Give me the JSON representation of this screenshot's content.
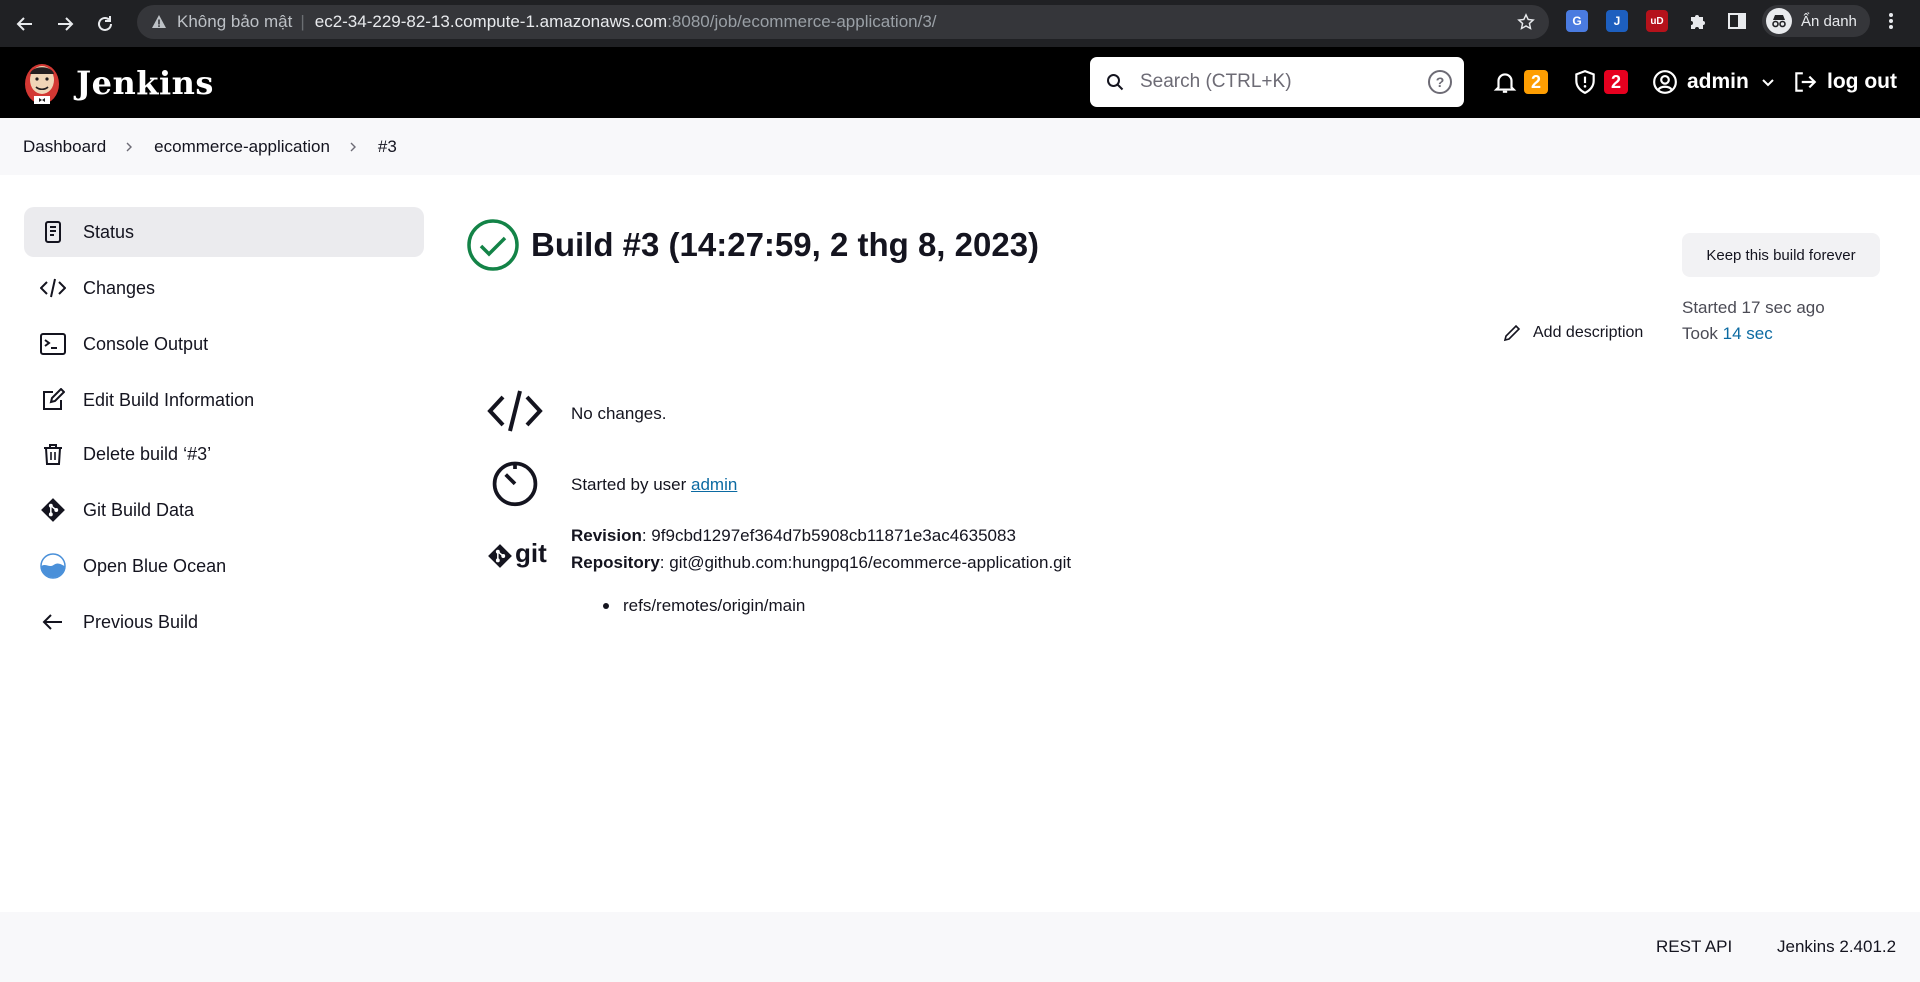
{
  "browser": {
    "insecure_label": "Không bảo mật",
    "url_host": "ec2-34-229-82-13.compute-1.amazonaws.com",
    "url_path": ":8080/job/ecommerce-application/3/",
    "profile_label": "Ẩn danh"
  },
  "header": {
    "brand": "Jenkins",
    "search_placeholder": "Search (CTRL+K)",
    "notifications_count": "2",
    "security_count": "2",
    "user": "admin",
    "logout": "log out",
    "colors": {
      "notif_badge": "#fe9e02",
      "security_badge": "#e6001f"
    }
  },
  "breadcrumb": [
    "Dashboard",
    "ecommerce-application",
    "#3"
  ],
  "sidebar": {
    "items": [
      {
        "label": "Status",
        "icon": "status-icon"
      },
      {
        "label": "Changes",
        "icon": "code-icon"
      },
      {
        "label": "Console Output",
        "icon": "terminal-icon"
      },
      {
        "label": "Edit Build Information",
        "icon": "edit-icon"
      },
      {
        "label": "Delete build ‘#3’",
        "icon": "trash-icon"
      },
      {
        "label": "Git Build Data",
        "icon": "git-icon"
      },
      {
        "label": "Open Blue Ocean",
        "icon": "blue-ocean-icon"
      },
      {
        "label": "Previous Build",
        "icon": "arrow-left-icon"
      }
    ]
  },
  "build": {
    "title": "Build #3 (14:27:59, 2 thg 8, 2023)",
    "keep_label": "Keep this build forever",
    "add_description": "Add description",
    "started": "Started 17 sec ago",
    "took_prefix": "Took",
    "took_value": "14 sec",
    "changes": "No changes.",
    "started_by_prefix": "Started by user",
    "started_by_user": "admin",
    "git_logo": "git",
    "revision_label": "Revision",
    "revision_value": ": 9f9cbd1297ef364d7b5908cb11871e3ac4635083",
    "repository_label": "Repository",
    "repository_value": ": git@github.com:hungpq16/ecommerce-application.git",
    "branch": "refs/remotes/origin/main",
    "success_color": "#138347"
  },
  "footer": {
    "rest_api": "REST API",
    "version": "Jenkins 2.401.2"
  }
}
